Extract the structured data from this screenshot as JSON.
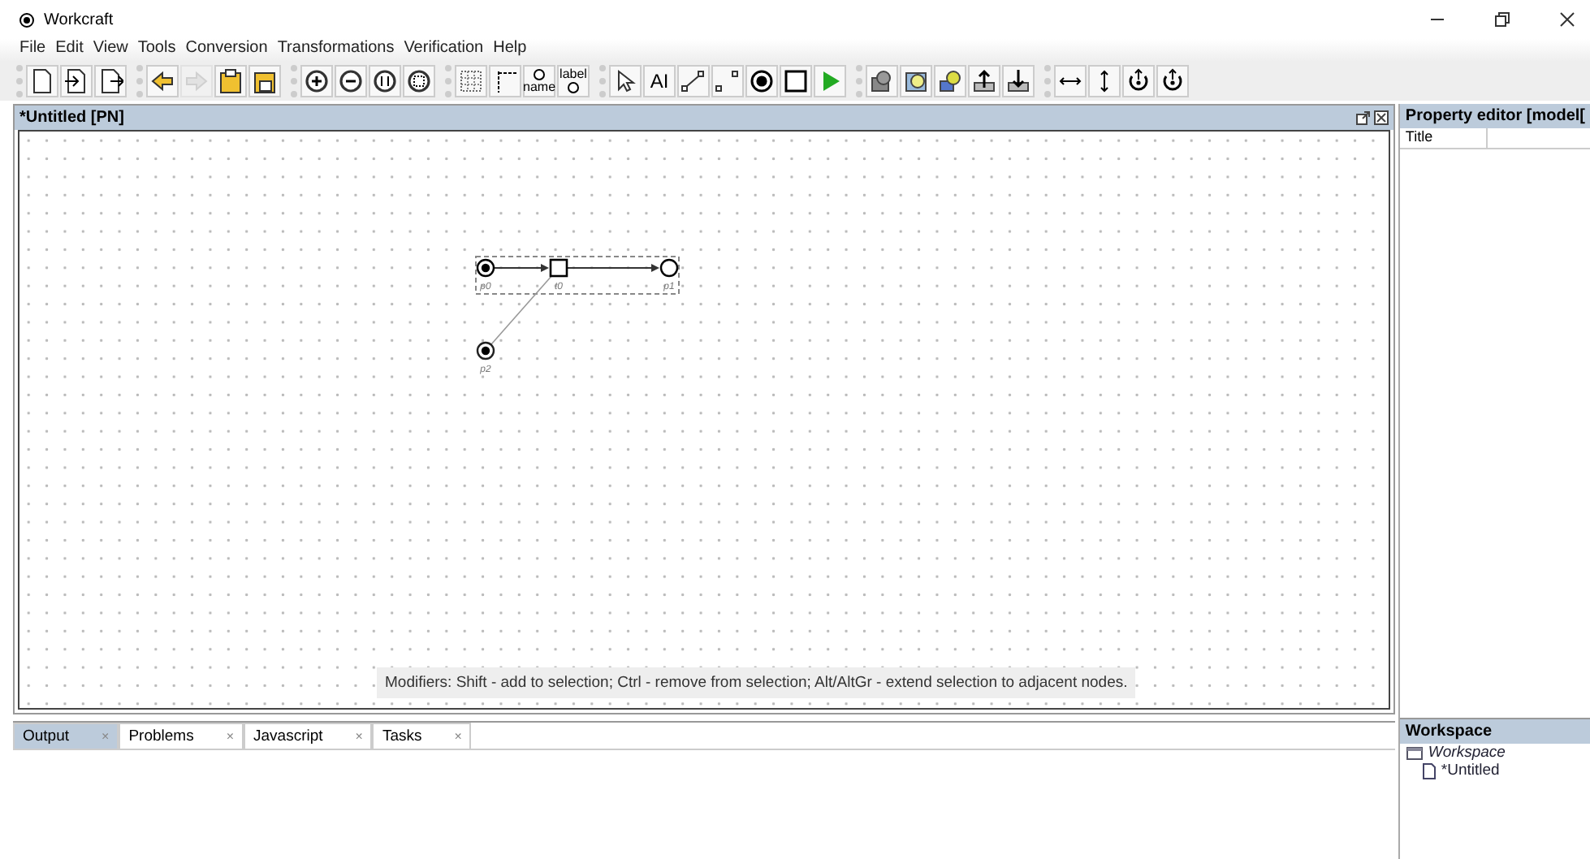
{
  "window": {
    "title": "Workcraft"
  },
  "menu": [
    "File",
    "Edit",
    "View",
    "Tools",
    "Conversion",
    "Transformations",
    "Verification",
    "Help"
  ],
  "toolbar": {
    "redo_disabled": true,
    "name_caption": "name",
    "label_caption": "label",
    "text_tool_caption": "AI"
  },
  "editor": {
    "title": "*Untitled [PN]",
    "nodes": [
      {
        "kind": "place",
        "label": "p0",
        "marked": true,
        "selected": true
      },
      {
        "kind": "transition",
        "label": "t0",
        "selected": true
      },
      {
        "kind": "place",
        "label": "p1",
        "marked": false,
        "selected": true
      },
      {
        "kind": "place",
        "label": "p2",
        "marked": true,
        "selected": false
      }
    ],
    "arcs": [
      {
        "selected": true
      },
      {
        "selected": true
      },
      {
        "selected": false
      }
    ],
    "hint": "Modifiers: Shift - add to selection; Ctrl - remove from selection; Alt/AltGr - extend selection to adjacent nodes."
  },
  "bottom_tabs": [
    {
      "label": "Output",
      "close": "×",
      "selected": true
    },
    {
      "label": "Problems",
      "close": "×",
      "selected": false
    },
    {
      "label": "Javascript",
      "close": "×",
      "selected": false
    },
    {
      "label": "Tasks",
      "close": "×",
      "selected": false
    }
  ],
  "property_editor": {
    "title": "Property editor [model[",
    "columns": [
      "Title"
    ]
  },
  "workspace": {
    "title": "Workspace",
    "tree": [
      {
        "label": "Workspace",
        "children": [
          {
            "label": "*Untitled"
          }
        ]
      }
    ]
  }
}
